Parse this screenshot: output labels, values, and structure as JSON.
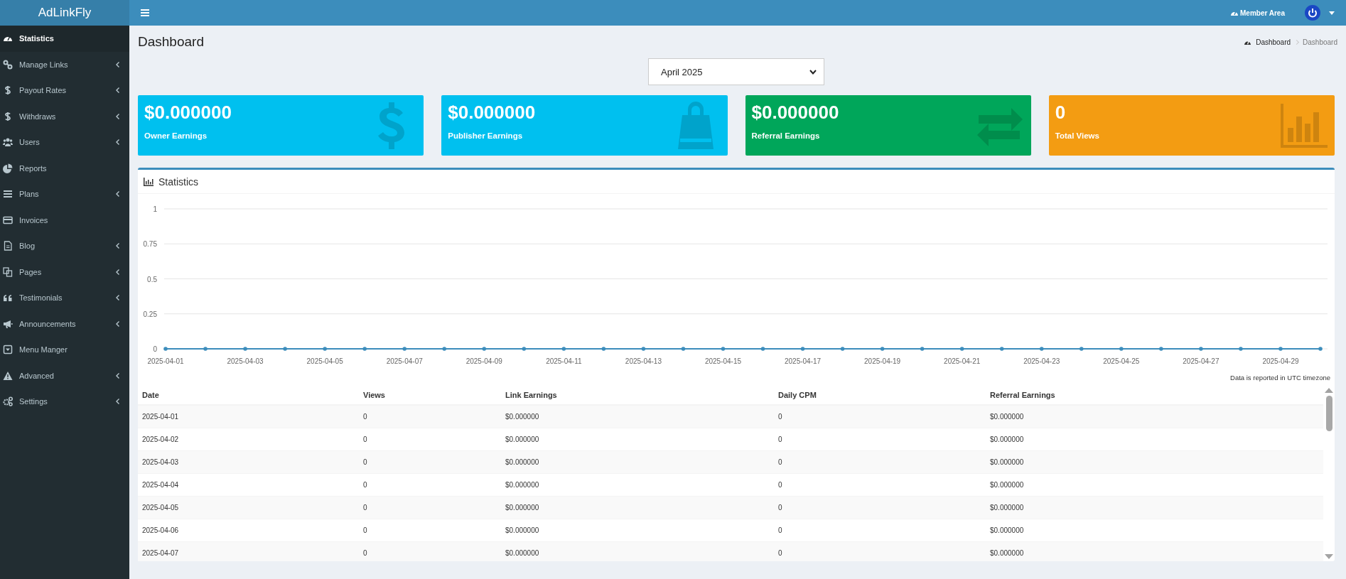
{
  "brand": "AdLinkFly",
  "header": {
    "member_area": "Member Area"
  },
  "sidebar": {
    "items": [
      {
        "label": "Statistics",
        "selected": true,
        "has_submenu": false
      },
      {
        "label": "Manage Links",
        "selected": false,
        "has_submenu": true
      },
      {
        "label": "Payout Rates",
        "selected": false,
        "has_submenu": true
      },
      {
        "label": "Withdraws",
        "selected": false,
        "has_submenu": true
      },
      {
        "label": "Users",
        "selected": false,
        "has_submenu": true
      },
      {
        "label": "Reports",
        "selected": false,
        "has_submenu": false
      },
      {
        "label": "Plans",
        "selected": false,
        "has_submenu": true
      },
      {
        "label": "Invoices",
        "selected": false,
        "has_submenu": false
      },
      {
        "label": "Blog",
        "selected": false,
        "has_submenu": true
      },
      {
        "label": "Pages",
        "selected": false,
        "has_submenu": true
      },
      {
        "label": "Testimonials",
        "selected": false,
        "has_submenu": true
      },
      {
        "label": "Announcements",
        "selected": false,
        "has_submenu": true
      },
      {
        "label": "Menu Manger",
        "selected": false,
        "has_submenu": false
      },
      {
        "label": "Advanced",
        "selected": false,
        "has_submenu": true
      },
      {
        "label": "Settings",
        "selected": false,
        "has_submenu": true
      }
    ]
  },
  "page": {
    "title": "Dashboard",
    "breadcrumb": [
      "Dashboard",
      "Dashboard"
    ]
  },
  "month_select": {
    "value": "April 2025"
  },
  "cards": [
    {
      "value": "$0.000000",
      "label": "Owner Earnings",
      "color": "#00c0ef"
    },
    {
      "value": "$0.000000",
      "label": "Publisher Earnings",
      "color": "#00c0ef"
    },
    {
      "value": "$0.000000",
      "label": "Referral Earnings",
      "color": "#00a65a"
    },
    {
      "value": "0",
      "label": "Total Views",
      "color": "#f39c12"
    }
  ],
  "statistics": {
    "title": "Statistics",
    "chart_data": {
      "type": "line",
      "ylim": [
        0,
        1
      ],
      "yticks": [
        0,
        0.25,
        0.5,
        0.75,
        1
      ],
      "grid": true,
      "categories": [
        "2025-04-01",
        null,
        "2025-04-03",
        null,
        "2025-04-05",
        null,
        "2025-04-07",
        null,
        "2025-04-09",
        null,
        "2025-04-11",
        null,
        "2025-04-13",
        null,
        "2025-04-15",
        null,
        "2025-04-17",
        null,
        "2025-04-19",
        null,
        "2025-04-21",
        null,
        "2025-04-23",
        null,
        "2025-04-25",
        null,
        "2025-04-27",
        null,
        "2025-04-29",
        null
      ],
      "series": [
        {
          "color": "#3c8dbc",
          "values": [
            0,
            0,
            0,
            0,
            0,
            0,
            0,
            0,
            0,
            0,
            0,
            0,
            0,
            0,
            0,
            0,
            0,
            0,
            0,
            0,
            0,
            0,
            0,
            0,
            0,
            0,
            0,
            0,
            0,
            0
          ]
        }
      ]
    },
    "note": "Data is reported in UTC timezone",
    "table": {
      "columns": [
        "Date",
        "Views",
        "Link Earnings",
        "Daily CPM",
        "Referral Earnings"
      ],
      "rows": [
        [
          "2025-04-01",
          "0",
          "$0.000000",
          "0",
          "$0.000000"
        ],
        [
          "2025-04-02",
          "0",
          "$0.000000",
          "0",
          "$0.000000"
        ],
        [
          "2025-04-03",
          "0",
          "$0.000000",
          "0",
          "$0.000000"
        ],
        [
          "2025-04-04",
          "0",
          "$0.000000",
          "0",
          "$0.000000"
        ],
        [
          "2025-04-05",
          "0",
          "$0.000000",
          "0",
          "$0.000000"
        ],
        [
          "2025-04-06",
          "0",
          "$0.000000",
          "0",
          "$0.000000"
        ],
        [
          "2025-04-07",
          "0",
          "$0.000000",
          "0",
          "$0.000000"
        ]
      ]
    }
  }
}
